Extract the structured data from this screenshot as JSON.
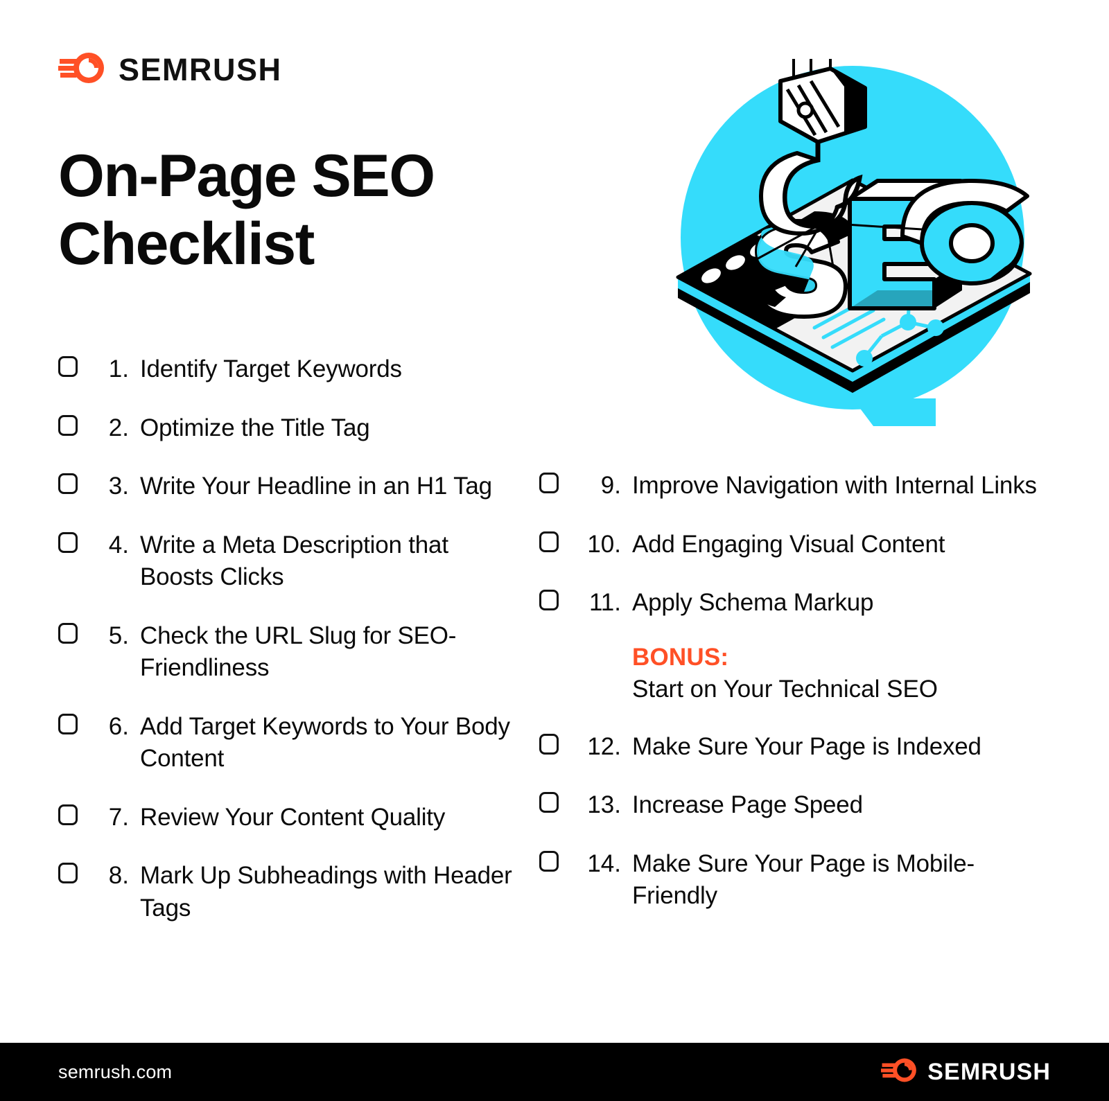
{
  "brand": {
    "name": "SEMRUSH",
    "logo_icon": "semrush-comet-icon",
    "orange": "#FF5026"
  },
  "title": "On-Page SEO Checklist",
  "illustration": {
    "name": "seo-crane-tablet-illustration",
    "letters": "SEO",
    "circle_color": "#35DCFB",
    "accent_dark": "#000000"
  },
  "checklist": {
    "left_column": [
      {
        "num": "1.",
        "text": "Identify Target Keywords"
      },
      {
        "num": "2.",
        "text": "Optimize the Title Tag"
      },
      {
        "num": "3.",
        "text": "Write Your Headline in an H1 Tag"
      },
      {
        "num": "4.",
        "text": "Write a Meta Description that Boosts Clicks"
      },
      {
        "num": "5.",
        "text": "Check the URL Slug for SEO-Friendliness"
      },
      {
        "num": "6.",
        "text": "Add Target Keywords to Your Body Content"
      },
      {
        "num": "7.",
        "text": "Review Your Content Quality"
      },
      {
        "num": "8.",
        "text": "Mark Up Subheadings with Header Tags"
      }
    ],
    "right_column_top": [
      {
        "num": "9.",
        "text": "Improve Navigation with Internal Links"
      },
      {
        "num": "10.",
        "text": "Add Engaging Visual Content"
      },
      {
        "num": "11.",
        "text": "Apply Schema Markup"
      }
    ],
    "bonus": {
      "label": "BONUS:",
      "text": "Start on Your Technical SEO",
      "color": "#FF5026"
    },
    "right_column_bottom": [
      {
        "num": "12.",
        "text": "Make Sure Your Page is Indexed"
      },
      {
        "num": "13.",
        "text": "Increase Page Speed"
      },
      {
        "num": "14.",
        "text": "Make Sure Your Page is Mobile-Friendly"
      }
    ]
  },
  "footer": {
    "url": "semrush.com",
    "brand": "SEMRUSH"
  }
}
